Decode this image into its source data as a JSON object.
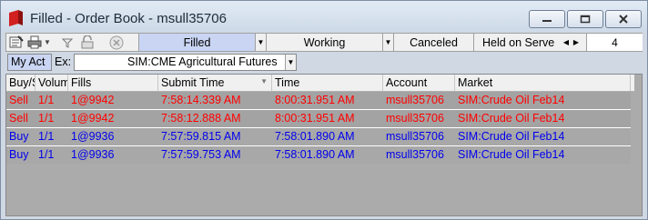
{
  "window": {
    "title": "Filled - Order Book - msull35706"
  },
  "toolbar": {
    "icons": [
      "properties-icon",
      "print-icon",
      "dropdown-icon",
      "filter-icon",
      "lock-icon",
      "cancel-order-icon"
    ],
    "tabs": [
      {
        "label": "Filled",
        "active": true
      },
      {
        "label": "Working",
        "active": false
      },
      {
        "label": "Canceled",
        "active": false
      },
      {
        "label": "Held on Serve",
        "active": false
      }
    ],
    "count": "4"
  },
  "account_bar": {
    "account_button": "My Act",
    "exchange_label": "Ex:",
    "exchange_value": "SIM:CME Agricultural Futures"
  },
  "grid": {
    "columns": [
      "Buy/Se",
      "Volum",
      "Fills",
      "Submit Time",
      "Time",
      "Account",
      "Market"
    ],
    "rows": [
      {
        "side": "Sell",
        "volume": "1/1",
        "fills": "1@9942",
        "submit_time": "7:58:14.339 AM",
        "time": "8:00:31.951 AM",
        "account": "msull35706",
        "market": "SIM:Crude Oil Feb14",
        "color": "#ff0000"
      },
      {
        "side": "Sell",
        "volume": "1/1",
        "fills": "1@9942",
        "submit_time": "7:58:12.888 AM",
        "time": "8:00:31.951 AM",
        "account": "msull35706",
        "market": "SIM:Crude Oil Feb14",
        "color": "#ff0000"
      },
      {
        "side": "Buy",
        "volume": "1/1",
        "fills": "1@9936",
        "submit_time": "7:57:59.815 AM",
        "time": "7:58:01.890 AM",
        "account": "msull35706",
        "market": "SIM:Crude Oil Feb14",
        "color": "#0000ee"
      },
      {
        "side": "Buy",
        "volume": "1/1",
        "fills": "1@9936",
        "submit_time": "7:57:59.753 AM",
        "time": "7:58:01.890 AM",
        "account": "msull35706",
        "market": "SIM:Crude Oil Feb14",
        "color": "#0000ee"
      }
    ]
  }
}
